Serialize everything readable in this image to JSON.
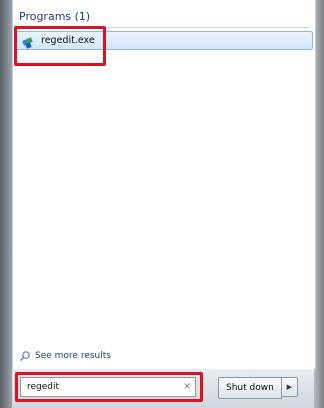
{
  "section": {
    "header": "Programs (1)"
  },
  "results": [
    {
      "label": "regedit.exe",
      "icon": "regedit-icon"
    }
  ],
  "see_more": {
    "label": "See more results",
    "icon": "search-icon"
  },
  "search": {
    "value": "regedit",
    "clear_glyph": "×"
  },
  "shutdown": {
    "label": "Shut down",
    "arrow_glyph": "▶"
  },
  "colors": {
    "highlight": "#d7141f",
    "link": "#1a3d8f",
    "header": "#1e3a8c",
    "selection": "#d2e6fb"
  }
}
